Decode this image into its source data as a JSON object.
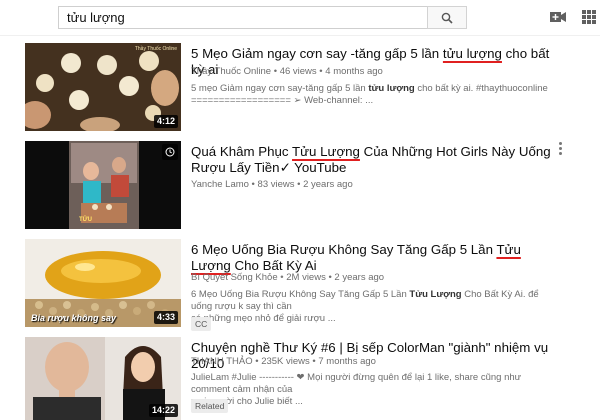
{
  "search": {
    "query": "tửu lượng"
  },
  "results": [
    {
      "title_before": "5 Mẹo Giảm ngay cơn say -tăng gấp 5 lần ",
      "title_mark": "tửu lượng",
      "title_after": " cho bất kỳ ai",
      "channel": "Thầy Thuốc Online",
      "meta": "46 views • 4 months ago",
      "desc_line1_a": "5 mẹo Giảm ngay cơn say-tăng gấp 5 lần ",
      "desc_line1_b": "tửu lượng",
      "desc_line1_c": " cho bất kỳ ai. #thaythuoconline",
      "desc_line2": "================== ➢ Web-channel: ...",
      "duration": "4:12",
      "thumb_text": "Thầy Thuốc Online"
    },
    {
      "title_before": "Quá Khâm Phục ",
      "title_mark": "Tửu Lượng",
      "title_after": " Của Những Hot Girls Này Uống Rượu Lấy Tiền✓ YouTube",
      "channel": "Yanche Lamo",
      "meta": "83 views • 2 years ago",
      "thumb_text": "TỬU"
    },
    {
      "title_before": "6 Mẹo Uống Bia Rượu Không Say Tăng Gấp 5 Lần ",
      "title_mark": "Tửu Lượng",
      "title_after": " Cho Bất Kỳ Ai",
      "channel": "Bí Quyết Sống Khỏe",
      "meta": "2M views • 2 years ago",
      "desc_line1_a": "6 Mẹo Uống Bia Rượu Không Say Tăng Gấp 5 Lần ",
      "desc_line1_b": "Tửu Lượng",
      "desc_line1_c": " Cho Bất Kỳ Ai. để uống rượu k say thì cần",
      "desc_line2": "có những mẹo nhỏ để giải rượu ...",
      "badge": "CC",
      "duration": "4:33",
      "thumb_text": "Bia rượu không say"
    },
    {
      "title": "Chuyện nghề Thư Ký #6 | Bị sếp ColorMan \"giành\" nhiệm vụ 20/10",
      "channel": "THANH THẢO",
      "meta": "235K views • 7 months ago",
      "desc_line1": "JulieLam #Julie ----------- ❤ Mọi người đừng quên để lại 1 like, share cũng như comment cảm nhận của",
      "desc_line2": "mọi người cho Julie biết ...",
      "badge": "Related",
      "duration": "14:22"
    }
  ]
}
